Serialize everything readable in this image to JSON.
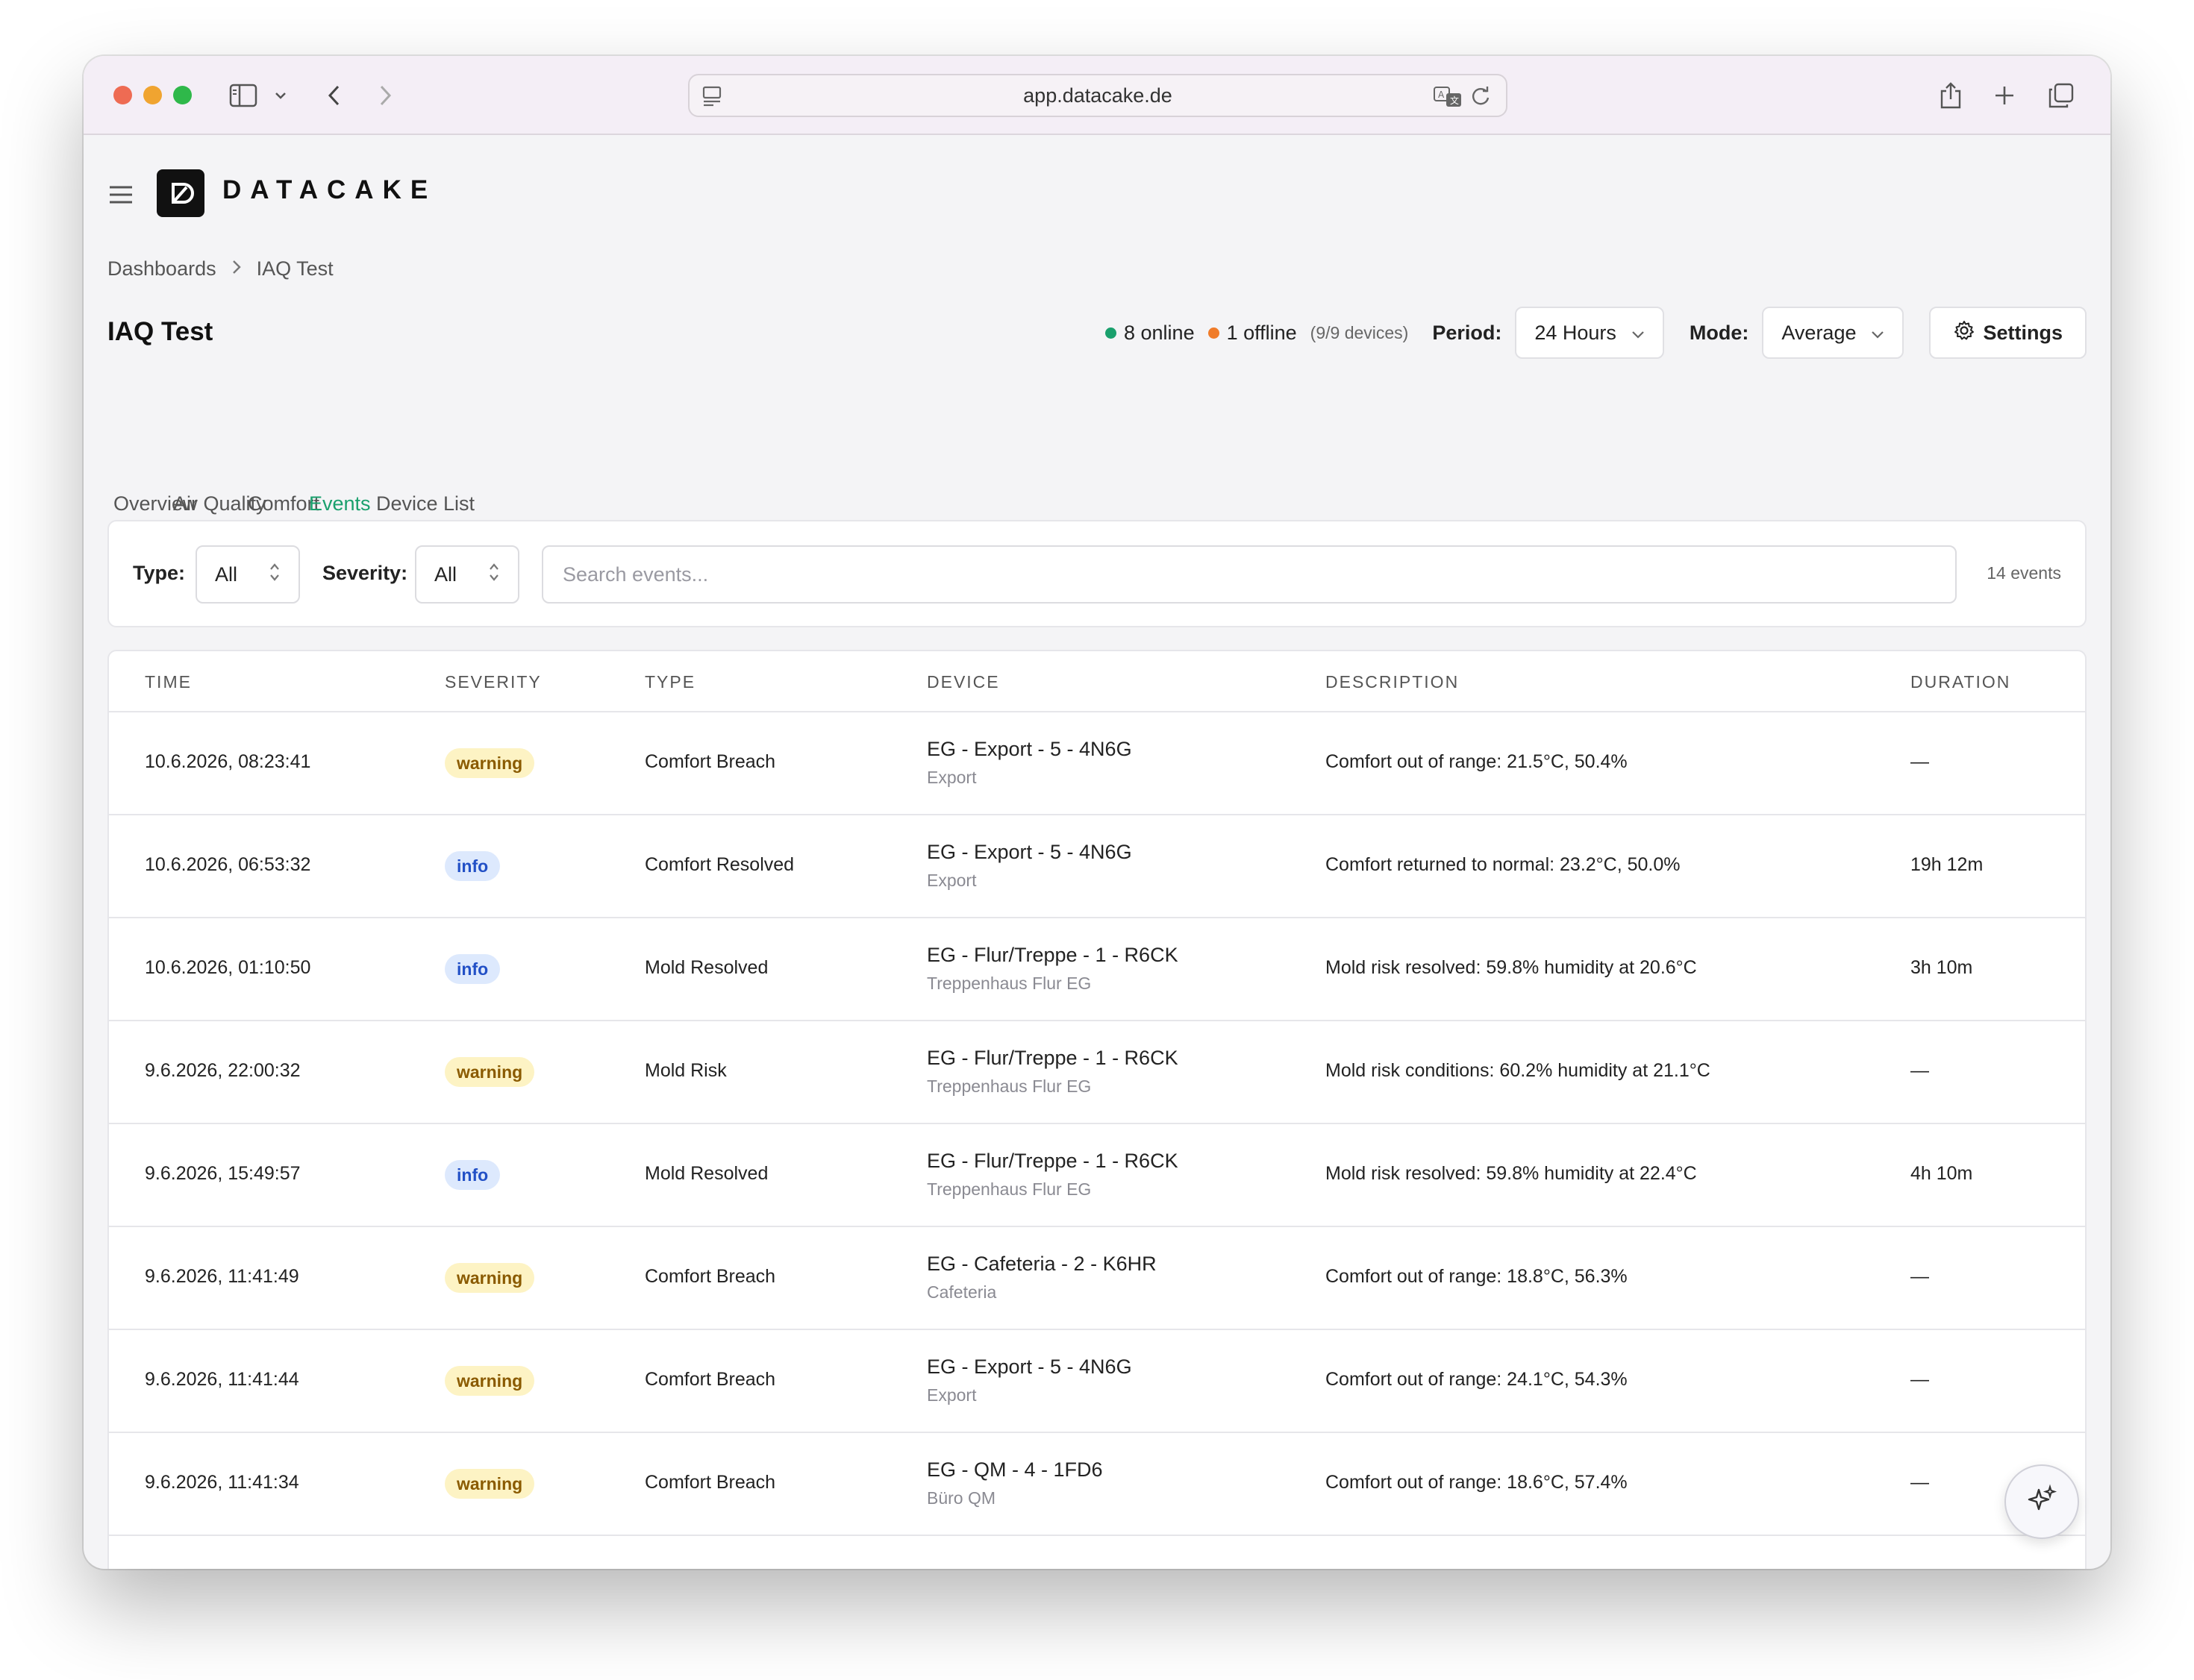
{
  "browser": {
    "url": "app.datacake.de",
    "traffic_colors": [
      "#ee6b53",
      "#f0a430",
      "#2fb84a"
    ]
  },
  "app": {
    "logo_text": "DATACAKE"
  },
  "breadcrumb": {
    "root": "Dashboards",
    "current": "IAQ Test"
  },
  "page": {
    "title": "IAQ Test"
  },
  "status": {
    "online": "8 online",
    "offline": "1 offline",
    "devices": "(9/9 devices)",
    "online_color": "#1aa06d",
    "offline_color": "#f07c2a"
  },
  "controls": {
    "period_label": "Period:",
    "period_value": "24 Hours",
    "mode_label": "Mode:",
    "mode_value": "Average",
    "settings_label": "Settings"
  },
  "tabs": [
    "Overview",
    "Air Quality",
    "Comfort",
    "Events",
    "Device List"
  ],
  "active_tab": "Events",
  "filters": {
    "type_label": "Type:",
    "type_value": "All",
    "severity_label": "Severity:",
    "severity_value": "All",
    "search_placeholder": "Search events...",
    "count": "14 events"
  },
  "table": {
    "headers": [
      "TIME",
      "SEVERITY",
      "TYPE",
      "DEVICE",
      "DESCRIPTION",
      "DURATION"
    ],
    "rows": [
      {
        "time": "10.6.2026, 08:23:41",
        "severity": "warning",
        "type": "Comfort Breach",
        "device": "EG - Export - 5 - 4N6G",
        "location": "Export",
        "description": "Comfort out of range: 21.5°C, 50.4%",
        "duration": "—"
      },
      {
        "time": "10.6.2026, 06:53:32",
        "severity": "info",
        "type": "Comfort Resolved",
        "device": "EG - Export - 5 - 4N6G",
        "location": "Export",
        "description": "Comfort returned to normal: 23.2°C, 50.0%",
        "duration": "19h 12m"
      },
      {
        "time": "10.6.2026, 01:10:50",
        "severity": "info",
        "type": "Mold Resolved",
        "device": "EG - Flur/Treppe - 1 - R6CK",
        "location": "Treppenhaus Flur EG",
        "description": "Mold risk resolved: 59.8% humidity at 20.6°C",
        "duration": "3h 10m"
      },
      {
        "time": "9.6.2026, 22:00:32",
        "severity": "warning",
        "type": "Mold Risk",
        "device": "EG - Flur/Treppe - 1 - R6CK",
        "location": "Treppenhaus Flur EG",
        "description": "Mold risk conditions: 60.2% humidity at 21.1°C",
        "duration": "—"
      },
      {
        "time": "9.6.2026, 15:49:57",
        "severity": "info",
        "type": "Mold Resolved",
        "device": "EG - Flur/Treppe - 1 - R6CK",
        "location": "Treppenhaus Flur EG",
        "description": "Mold risk resolved: 59.8% humidity at 22.4°C",
        "duration": "4h 10m"
      },
      {
        "time": "9.6.2026, 11:41:49",
        "severity": "warning",
        "type": "Comfort Breach",
        "device": "EG - Cafeteria - 2 - K6HR",
        "location": "Cafeteria",
        "description": "Comfort out of range: 18.8°C, 56.3%",
        "duration": "—"
      },
      {
        "time": "9.6.2026, 11:41:44",
        "severity": "warning",
        "type": "Comfort Breach",
        "device": "EG - Export - 5 - 4N6G",
        "location": "Export",
        "description": "Comfort out of range: 24.1°C, 54.3%",
        "duration": "—"
      },
      {
        "time": "9.6.2026, 11:41:34",
        "severity": "warning",
        "type": "Comfort Breach",
        "device": "EG - QM - 4 - 1FD6",
        "location": "Büro QM",
        "description": "Comfort out of range: 18.6°C, 57.4%",
        "duration": "—"
      }
    ]
  }
}
